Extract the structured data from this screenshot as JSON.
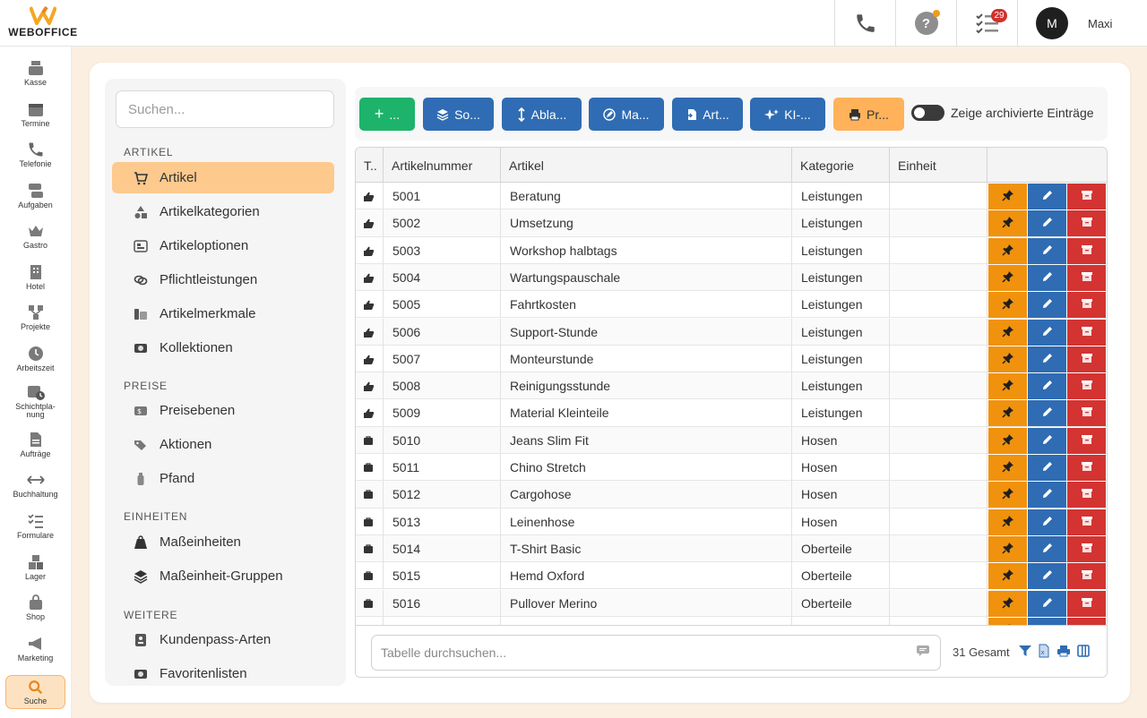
{
  "brand": {
    "name": "WEBOFFICE",
    "accent": "#f5a623"
  },
  "topbar": {
    "phone_icon": "phone-icon",
    "help_label": "?",
    "tasks_badge": "29",
    "user_initial": "M",
    "user_name": "Maxi"
  },
  "nav": [
    {
      "label": "Kasse",
      "icon": "cash-register-icon"
    },
    {
      "label": "Termine",
      "icon": "calendar-icon"
    },
    {
      "label": "Telefonie",
      "icon": "phone-icon"
    },
    {
      "label": "Aufgaben",
      "icon": "tasks-icon"
    },
    {
      "label": "Gastro",
      "icon": "crown-icon"
    },
    {
      "label": "Hotel",
      "icon": "building-icon"
    },
    {
      "label": "Projekte",
      "icon": "project-icon"
    },
    {
      "label": "Arbeitszeit",
      "icon": "clock-icon"
    },
    {
      "label": "Schichtpla-\nnung",
      "icon": "calendar-clock-icon"
    },
    {
      "label": "Aufträge",
      "icon": "document-icon"
    },
    {
      "label": "Buchhaltung",
      "icon": "arrows-icon"
    },
    {
      "label": "Formulare",
      "icon": "checklist-icon"
    },
    {
      "label": "Lager",
      "icon": "boxes-icon"
    },
    {
      "label": "Shop",
      "icon": "bag-icon"
    },
    {
      "label": "Marketing",
      "icon": "megaphone-icon"
    },
    {
      "label": "Suche",
      "icon": "search-icon"
    }
  ],
  "side": {
    "search_placeholder": "Suchen...",
    "sections": [
      {
        "title": "ARTIKEL",
        "items": [
          "Artikel",
          "Artikelkategorien",
          "Artikeloptionen",
          "Pflichtleistungen",
          "Artikelmerkmale",
          "Kollektionen"
        ]
      },
      {
        "title": "PREISE",
        "items": [
          "Preisebenen",
          "Aktionen",
          "Pfand"
        ]
      },
      {
        "title": "EINHEITEN",
        "items": [
          "Maßeinheiten",
          "Maßeinheit-Gruppen"
        ]
      },
      {
        "title": "WEITERE",
        "items": [
          "Kundenpass-Arten",
          "Favoritenlisten"
        ]
      }
    ]
  },
  "toolbar": {
    "add": "...",
    "sort": "So...",
    "ablage": "Abla...",
    "mass": "Ma...",
    "art": "Art...",
    "ki": "KI-...",
    "print": "Pr...",
    "toggle_label": "Zeige archivierte Einträge"
  },
  "table": {
    "headers": [
      "T..",
      "Artikelnummer",
      "Artikel",
      "Kategorie",
      "Einheit"
    ],
    "rows": [
      {
        "type": "service",
        "nr": "5001",
        "name": "Beratung",
        "cat": "Leistungen",
        "unit": ""
      },
      {
        "type": "service",
        "nr": "5002",
        "name": "Umsetzung",
        "cat": "Leistungen",
        "unit": ""
      },
      {
        "type": "service",
        "nr": "5003",
        "name": "Workshop halbtags",
        "cat": "Leistungen",
        "unit": ""
      },
      {
        "type": "service",
        "nr": "5004",
        "name": "Wartungspauschale",
        "cat": "Leistungen",
        "unit": ""
      },
      {
        "type": "service",
        "nr": "5005",
        "name": "Fahrtkosten",
        "cat": "Leistungen",
        "unit": ""
      },
      {
        "type": "service",
        "nr": "5006",
        "name": "Support-Stunde",
        "cat": "Leistungen",
        "unit": ""
      },
      {
        "type": "service",
        "nr": "5007",
        "name": "Monteurstunde",
        "cat": "Leistungen",
        "unit": ""
      },
      {
        "type": "service",
        "nr": "5008",
        "name": "Reinigungsstunde",
        "cat": "Leistungen",
        "unit": ""
      },
      {
        "type": "service",
        "nr": "5009",
        "name": "Material Kleinteile",
        "cat": "Leistungen",
        "unit": ""
      },
      {
        "type": "product",
        "nr": "5010",
        "name": "Jeans Slim Fit",
        "cat": "Hosen",
        "unit": ""
      },
      {
        "type": "product",
        "nr": "5011",
        "name": "Chino Stretch",
        "cat": "Hosen",
        "unit": ""
      },
      {
        "type": "product",
        "nr": "5012",
        "name": "Cargohose",
        "cat": "Hosen",
        "unit": ""
      },
      {
        "type": "product",
        "nr": "5013",
        "name": "Leinenhose",
        "cat": "Hosen",
        "unit": ""
      },
      {
        "type": "product",
        "nr": "5014",
        "name": "T-Shirt Basic",
        "cat": "Oberteile",
        "unit": ""
      },
      {
        "type": "product",
        "nr": "5015",
        "name": "Hemd Oxford",
        "cat": "Oberteile",
        "unit": ""
      },
      {
        "type": "product",
        "nr": "5016",
        "name": "Pullover Merino",
        "cat": "Oberteile",
        "unit": ""
      },
      {
        "type": "product",
        "nr": "",
        "name": "",
        "cat": "",
        "unit": ""
      }
    ],
    "search_placeholder": "Tabelle durchsuchen...",
    "total": "31 Gesamt"
  },
  "colors": {
    "action_orange": "#f0920e",
    "action_blue": "#2f6cb3",
    "action_red": "#d33432",
    "active_item": "#fdc98d"
  }
}
